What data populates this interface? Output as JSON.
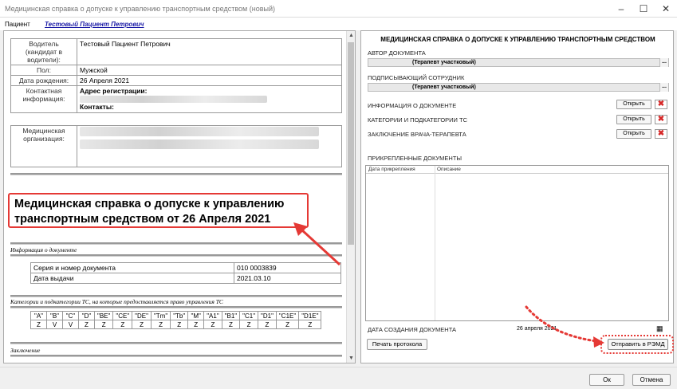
{
  "window": {
    "title": "Медицинская справка о допуске к управлению транспортным средством (новый)",
    "minimize": "–",
    "maximize": "☐",
    "close": "✕"
  },
  "menu": {
    "patient_label": "Пациент",
    "patient_link": "Тестовый Пациент Петрович"
  },
  "document": {
    "driver_label": "Водитель (кандидат в водители):",
    "driver_value": "Тестовый Пациент Петрович",
    "sex_label": "Пол:",
    "sex_value": "Мужской",
    "dob_label": "Дата рождения:",
    "dob_value": "26 Апреля 2021",
    "contact_label": "Контактная информация:",
    "address_label": "Адрес регистрации:",
    "contacts_label": "Контакты:",
    "org_label": "Медицинская организация:",
    "callout": "Медицинская справка о допуске к управлению транспортным средством от 26 Апреля 2021",
    "doc_info_title": "Информация о документе",
    "series_label": "Серия и номер документа",
    "series_value": "010 0003839",
    "issue_label": "Дата выдачи",
    "issue_value": "2021.03.10",
    "categories_title": "Категории и подкатегории ТС, на которые предоставляется право управления ТС",
    "categories": [
      "\"A\"",
      "\"B\"",
      "\"C\"",
      "\"D\"",
      "\"BE\"",
      "\"CE\"",
      "\"DE\"",
      "\"Tm\"",
      "\"Tb\"",
      "\"M\"",
      "\"A1\"",
      "\"B1\"",
      "\"C1\"",
      "\"D1\"",
      "\"C1E\"",
      "\"D1E\""
    ],
    "category_values": [
      "Z",
      "V",
      "V",
      "Z",
      "Z",
      "Z",
      "Z",
      "Z",
      "Z",
      "Z",
      "Z",
      "Z",
      "Z",
      "Z",
      "Z",
      "Z"
    ],
    "conclusion_title": "Заключение"
  },
  "right": {
    "heading": "МЕДИЦИНСКАЯ СПРАВКА О ДОПУСКЕ К УПРАВЛЕНИЮ ТРАНСПОРТНЫМ СРЕДСТВОМ",
    "author_label": "АВТОР ДОКУМЕНТА",
    "author_value": "(Терапевт участковый)",
    "signer_label": "ПОДПИСЫВАЮЩИЙ СОТРУДНИК",
    "signer_value": "(Терапевт участковый)",
    "dots": "...",
    "sections": [
      {
        "label": "ИНФОРМАЦИЯ О ДОКУМЕНТЕ",
        "button": "Открыть"
      },
      {
        "label": "КАТЕГОРИИ И ПОДКАТЕГОРИИ ТС",
        "button": "Открыть"
      },
      {
        "label": "ЗАКЛЮЧЕНИЕ ВРАЧА-ТЕРАПЕВТА",
        "button": "Открыть"
      }
    ],
    "delete_glyph": "✖",
    "attached_label": "ПРИКРЕПЛЕННЫЕ ДОКУМЕНТЫ",
    "grid_col1": "Дата прикрепления",
    "grid_col2": "Описание",
    "created_label": "ДАТА СОЗДАНИЯ ДОКУМЕНТА",
    "created_value": "26  апреля   2021",
    "print_button": "Печать протокола",
    "send_button": "Отправить в РЭМД"
  },
  "footer": {
    "ok": "Ок",
    "cancel": "Отмена"
  },
  "colors": {
    "annotation_red": "#e53935",
    "link_blue": "#1a1aa6"
  }
}
